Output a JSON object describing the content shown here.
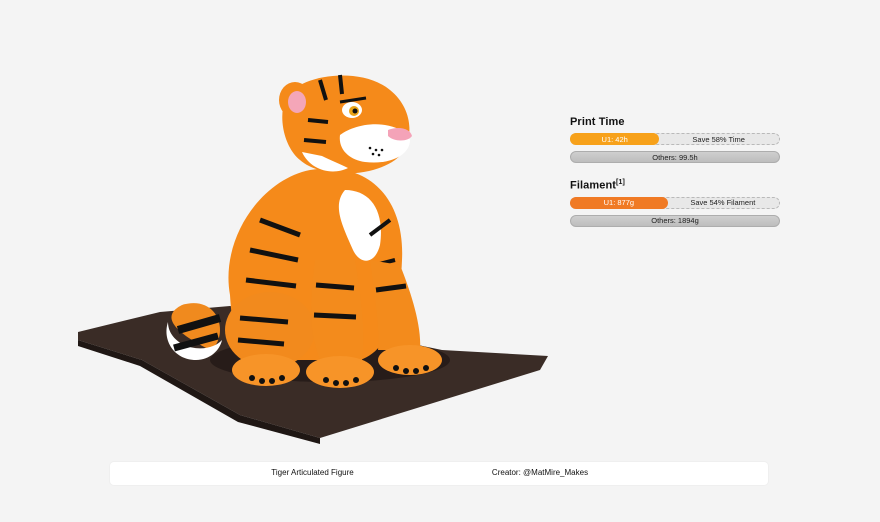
{
  "product_image": {
    "alt": "Orange tiger figure with black stripes sitting on a dark print bed"
  },
  "stats": {
    "print_time": {
      "title": "Print Time",
      "u1_label": "U1: 42h",
      "u1_fraction": 0.42,
      "save_label": "Save 58% Time",
      "others_label": "Others: 99.5h",
      "u1_color": "#f7a11a"
    },
    "filament": {
      "title": "Filament",
      "footnote": "[1]",
      "u1_label": "U1: 877g",
      "u1_fraction": 0.46,
      "save_label": "Save 54% Filament",
      "others_label": "Others: 1894g",
      "u1_color": "#f07a24"
    }
  },
  "footer": {
    "model_name": "Tiger Articulated Figure",
    "creator": "Creator: @MatMire_Makes"
  }
}
